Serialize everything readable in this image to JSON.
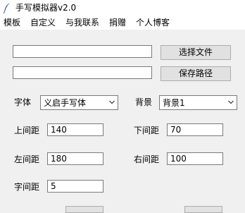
{
  "window": {
    "title": "手写模拟器v2.0"
  },
  "menu": {
    "items": [
      "模板",
      "自定义",
      "与我联系",
      "捐赠",
      "个人博客"
    ]
  },
  "file": {
    "path_value": "",
    "select_label": "选择文件"
  },
  "save": {
    "path_value": "",
    "button_label": "保存路径"
  },
  "font": {
    "label": "字体",
    "selected": "义启手写体"
  },
  "background": {
    "label": "背景",
    "selected": "背景1"
  },
  "margins": {
    "top": {
      "label": "上间距",
      "value": "140"
    },
    "bottom": {
      "label": "下间距",
      "value": "70"
    },
    "left": {
      "label": "左间距",
      "value": "180"
    },
    "right": {
      "label": "右间距",
      "value": "100"
    }
  },
  "char_spacing": {
    "label": "字间距",
    "value": "5"
  }
}
